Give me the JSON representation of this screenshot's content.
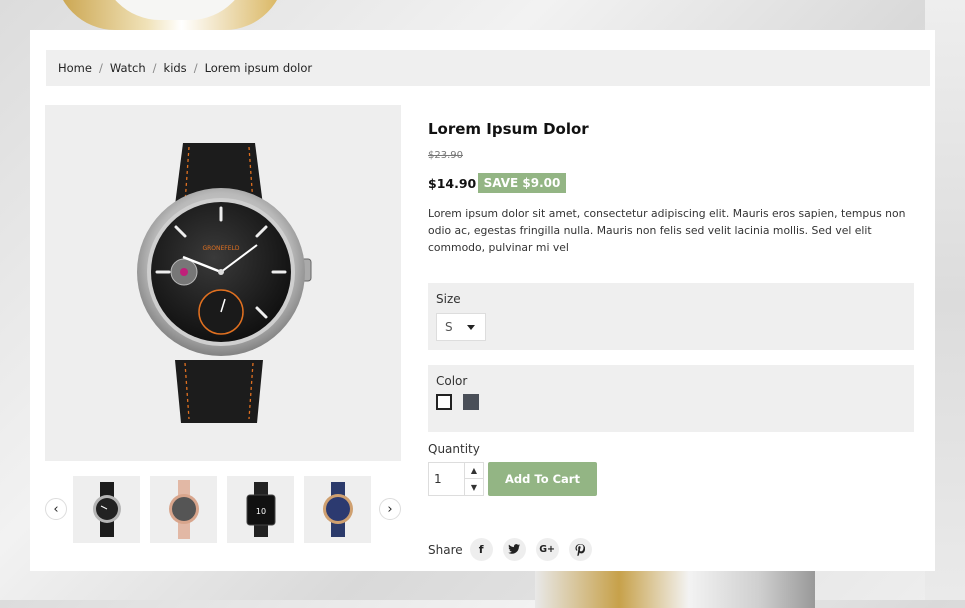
{
  "breadcrumb": {
    "items": [
      "Home",
      "Watch",
      "kids",
      "Lorem ipsum dolor"
    ]
  },
  "product": {
    "title": "Lorem Ipsum Dolor",
    "old_price": "$23.90",
    "price": "$14.90",
    "save_label": "SAVE $9.00",
    "description": "Lorem ipsum dolor sit amet, consectetur adipiscing elit. Mauris eros sapien, tempus non odio ac, egestas fringilla nulla. Mauris non felis sed velit lacinia mollis. Sed vel elit commodo, pulvinar mi vel",
    "watch_brand": "GRONEFELD"
  },
  "options": {
    "size": {
      "label": "Size",
      "selected": "S"
    },
    "color": {
      "label": "Color",
      "swatches": [
        "#ffffff",
        "#4a4f58"
      ]
    }
  },
  "quantity": {
    "label": "Quantity",
    "value": "1"
  },
  "cart": {
    "button_label": "Add To Cart"
  },
  "share": {
    "label": "Share",
    "networks": [
      "facebook",
      "twitter",
      "google-plus",
      "pinterest"
    ]
  },
  "thumb_smartwatch_text": "10",
  "colors": {
    "accent": "#93b584",
    "panel": "#efefef"
  }
}
